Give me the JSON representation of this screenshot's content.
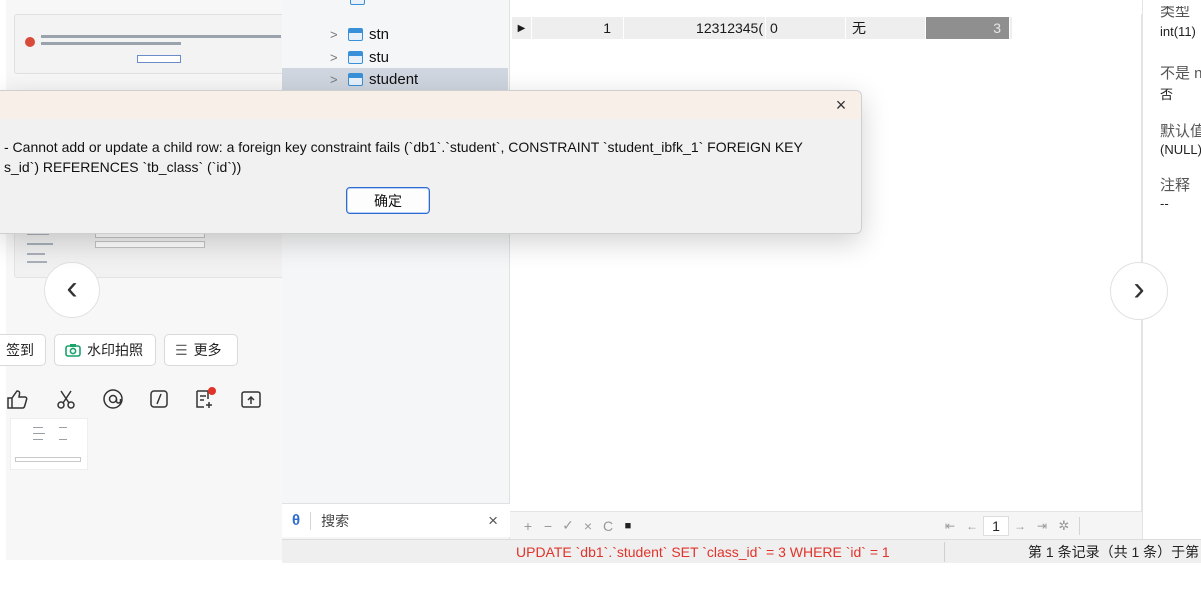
{
  "dialog": {
    "message_line1": "- Cannot add or update a child row: a foreign key constraint fails (`db1`.`student`, CONSTRAINT `student_ibfk_1` FOREIGN KEY",
    "message_line2": "s_id`) REFERENCES `tb_class` (`id`))",
    "ok_label": "确定",
    "close_icon": "×"
  },
  "tree": {
    "items": [
      {
        "label": "stn",
        "icon": "table-icon"
      },
      {
        "label": "stu",
        "icon": "table-icon"
      },
      {
        "label": "student",
        "icon": "table-icon",
        "selected": true
      }
    ]
  },
  "grid": {
    "row": {
      "marker": "▶",
      "id": "1",
      "phone": "12312345(",
      "col3": "0",
      "col4": "无",
      "class_id": "3"
    }
  },
  "props": {
    "type_label": "类型",
    "type_value": "int(11)",
    "notnull_label": "不是 n",
    "notnull_value": "否",
    "default_label": "默认值",
    "default_value": "(NULL)",
    "comment_label": "注释",
    "comment_value": "--"
  },
  "search": {
    "label": "搜索",
    "icon": "search-icon",
    "clear": "×"
  },
  "grid_toolbar": {
    "buttons": [
      "+",
      "−",
      "✓",
      "×",
      "C",
      "■"
    ],
    "page": "1"
  },
  "status": {
    "sql": "UPDATE `db1`.`student` SET `class_id` = 3 WHERE `id` = 1",
    "record_info": "第 1 条记录（共 1 条）于第"
  },
  "chat": {
    "signin_label": "签到",
    "watermark_label": "水印拍照",
    "more_label": "更多",
    "prev_icon": "‹",
    "next_icon": "›"
  },
  "colors": {
    "error_red": "#e0342b",
    "accent_blue": "#2d6bd1",
    "selected_row": "#cfd6df"
  }
}
